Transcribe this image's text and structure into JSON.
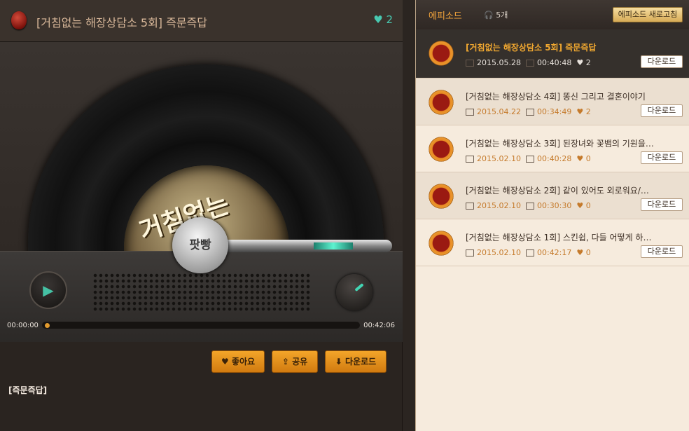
{
  "player": {
    "title": "[거침없는 해장상담소 5회] 즉문즉답",
    "likes": "2",
    "disc_label": "거침없는",
    "center_label": "팟빵",
    "time_current": "00:00:00",
    "time_total": "00:42:06",
    "progress_fraction": 0.0,
    "buttons": {
      "like": "좋아요",
      "share": "공유",
      "download": "다운로드"
    },
    "description": "[즉문즉답]"
  },
  "sidebar": {
    "title": "에피소드",
    "count": "5개",
    "refresh": "에피소드 새로고침",
    "episodes": [
      {
        "title": "[거침없는 해장상담소 5회] 즉문즉답",
        "date": "2015.05.28",
        "duration": "00:40:48",
        "likes": "2",
        "download": "다운로드"
      },
      {
        "title": "[거침없는 해장상담소 4회] 똥신 그리고 결혼이야기",
        "date": "2015.04.22",
        "duration": "00:34:49",
        "likes": "2",
        "download": "다운로드"
      },
      {
        "title": "[거침없는 해장상담소 3회] 된장녀와 꽃뱀의 기원을…",
        "date": "2015.02.10",
        "duration": "00:40:28",
        "likes": "0",
        "download": "다운로드"
      },
      {
        "title": "[거침없는 해장상담소 2회] 같이 있어도 외로워요/…",
        "date": "2015.02.10",
        "duration": "00:30:30",
        "likes": "0",
        "download": "다운로드"
      },
      {
        "title": "[거침없는 해장상담소 1회] 스킨쉽, 다들 어떻게 하…",
        "date": "2015.02.10",
        "duration": "00:42:17",
        "likes": "0",
        "download": "다운로드"
      }
    ]
  }
}
